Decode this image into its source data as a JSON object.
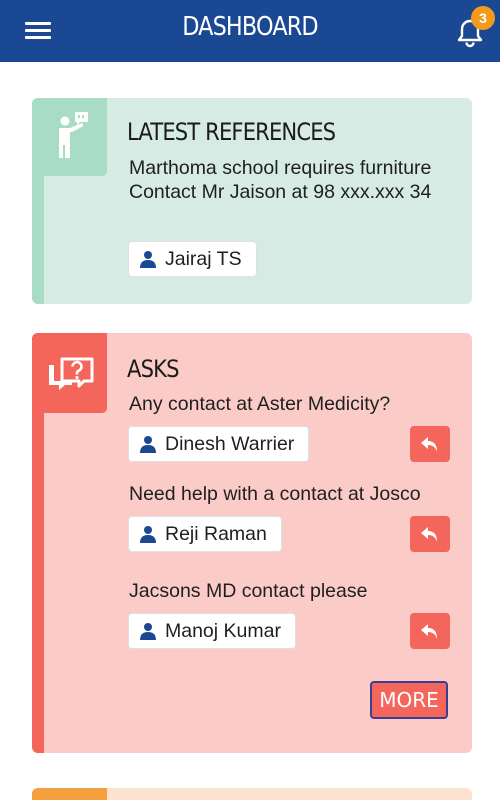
{
  "header": {
    "title": "DASHBOARD",
    "notification_count": "3"
  },
  "references": {
    "title": "LATEST REFERENCES",
    "text": "Marthoma school requires furniture Contact Mr Jaison at 98 xxx.xxx 34",
    "person": "Jairaj TS"
  },
  "asks": {
    "title": "ASKS",
    "items": [
      {
        "question": "Any contact at Aster Medicity?",
        "person": "Dinesh Warrier"
      },
      {
        "question": "Need help with a contact at Josco",
        "person": "Reji Raman"
      },
      {
        "question": "Jacsons MD contact please",
        "person": "Manoj Kumar"
      }
    ],
    "more_label": "MORE"
  },
  "icons": {
    "menu": "hamburger-menu-icon",
    "bell": "bell-icon",
    "references": "presenter-speech-icon",
    "asks": "question-bubble-icon",
    "person": "user-icon",
    "reply": "reply-icon"
  },
  "colors": {
    "header": "#1a4892",
    "badge": "#f39a1c",
    "references_bg": "#d5ebe3",
    "references_accent": "#a9dcc6",
    "asks_bg": "#fbcbc8",
    "asks_accent": "#f4665b",
    "next_accent": "#f4a13d"
  }
}
